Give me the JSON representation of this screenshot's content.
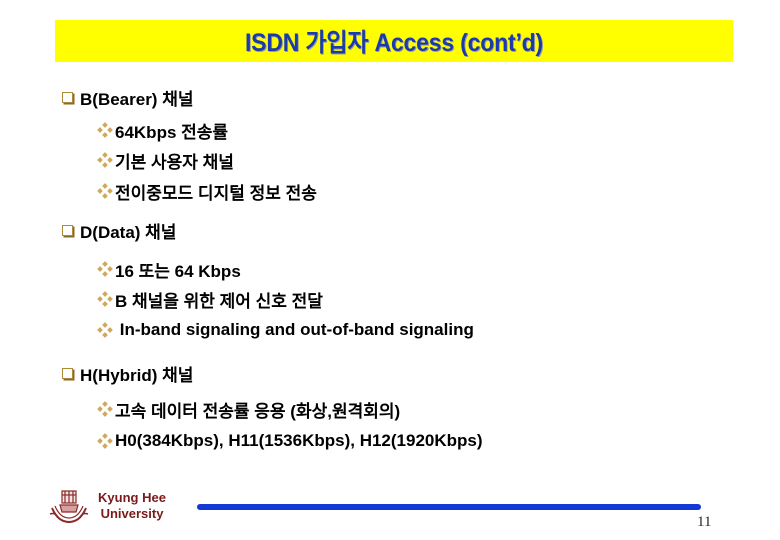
{
  "slide": {
    "title": "ISDN 가입자 Access (cont’d)",
    "accent_colors": {
      "title_bar": "#ffff00",
      "title_text": "#1a3aad",
      "bullet": "#d1a85a",
      "footer_line": "#1238d6",
      "university_text": "#7a1a1a"
    },
    "sections": [
      {
        "bullet_icon": "square-bullet",
        "heading": "B(Bearer) 채널",
        "items": [
          {
            "bullet_icon": "diamond-bullet",
            "text": "64Kbps 전송률"
          },
          {
            "bullet_icon": "diamond-bullet",
            "text": "기본 사용자 채널"
          },
          {
            "bullet_icon": "diamond-bullet",
            "text": "전이중모드 디지털 정보 전송"
          }
        ]
      },
      {
        "bullet_icon": "square-bullet",
        "heading": "D(Data) 채널",
        "items": [
          {
            "bullet_icon": "diamond-bullet",
            "text": "16 또는 64 Kbps"
          },
          {
            "bullet_icon": "diamond-bullet",
            "text": "B 채널을 위한 제어 신호 전달"
          },
          {
            "bullet_icon": "diamond-bullet",
            "text": " In-band signaling and out-of-band signaling"
          }
        ]
      },
      {
        "bullet_icon": "square-bullet",
        "heading": "H(Hybrid) 채널",
        "items": [
          {
            "bullet_icon": "diamond-bullet",
            "text": "고속 데이터 전송률 응용 (화상,원격회의)"
          },
          {
            "bullet_icon": "diamond-bullet",
            "text": "H0(384Kbps), H11(1536Kbps), H12(1920Kbps)"
          }
        ]
      }
    ],
    "footer": {
      "logo_icon": "university-emblem-icon",
      "university_line1": "Kyung Hee",
      "university_line2": "University",
      "page_number": "11"
    }
  }
}
